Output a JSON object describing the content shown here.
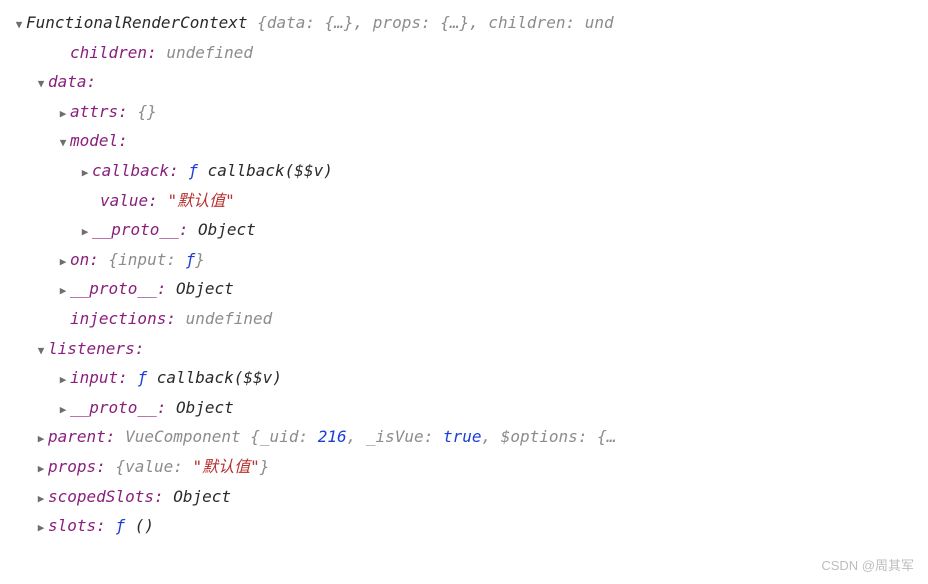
{
  "root": {
    "class_name": "FunctionalRenderContext",
    "preview": "{data: {…}, props: {…}, children: und"
  },
  "children": {
    "key": "children",
    "value": "undefined"
  },
  "data": {
    "key": "data",
    "attrs": {
      "key": "attrs",
      "preview": "{}"
    },
    "model": {
      "key": "model",
      "callback": {
        "key": "callback",
        "f": "ƒ",
        "sig": "callback($$v)"
      },
      "value": {
        "key": "value",
        "val": "\"默认值\""
      },
      "proto": {
        "key": "__proto__",
        "val": "Object"
      }
    },
    "on": {
      "key": "on",
      "preview": "{input: ƒ}"
    },
    "proto": {
      "key": "__proto__",
      "val": "Object"
    }
  },
  "injections": {
    "key": "injections",
    "value": "undefined"
  },
  "listeners": {
    "key": "listeners",
    "input": {
      "key": "input",
      "f": "ƒ",
      "sig": "callback($$v)"
    },
    "proto": {
      "key": "__proto__",
      "val": "Object"
    }
  },
  "parent": {
    "key": "parent",
    "class_name": "VueComponent",
    "uid_label": "_uid",
    "uid": "216",
    "isvue_label": "_isVue",
    "isvue": "true",
    "options_label": "$options",
    "options_trail": "{…"
  },
  "props": {
    "key": "props",
    "value_label": "value",
    "value": "\"默认值\""
  },
  "scopedSlots": {
    "key": "scopedSlots",
    "val": "Object"
  },
  "slots": {
    "key": "slots",
    "f": "ƒ",
    "sig": "()"
  },
  "watermark": "CSDN @周其军"
}
